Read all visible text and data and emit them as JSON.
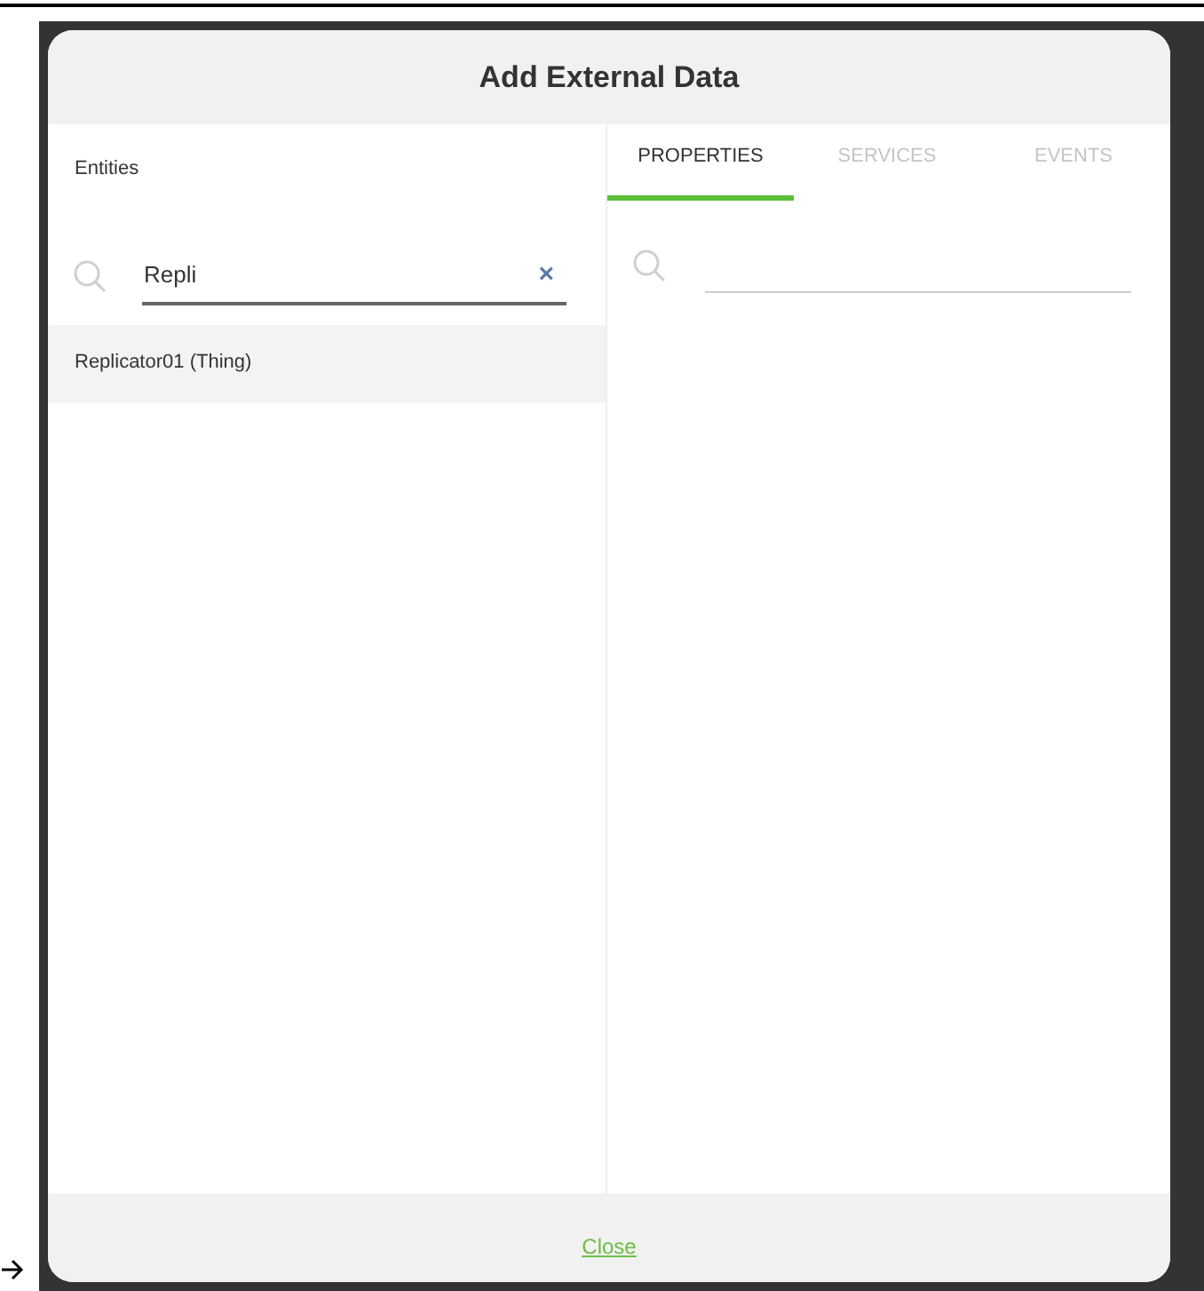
{
  "dialog": {
    "title": "Add External Data"
  },
  "entities": {
    "label": "Entities",
    "search": {
      "value": "Repli",
      "clear": "×"
    },
    "results": [
      {
        "label": "Replicator01 (Thing)",
        "selected": true
      }
    ]
  },
  "tabs": [
    {
      "label": "PROPERTIES",
      "selected": true
    },
    {
      "label": "SERVICES",
      "selected": false
    },
    {
      "label": "EVENTS",
      "selected": false
    }
  ],
  "footer": {
    "close": "Close"
  }
}
